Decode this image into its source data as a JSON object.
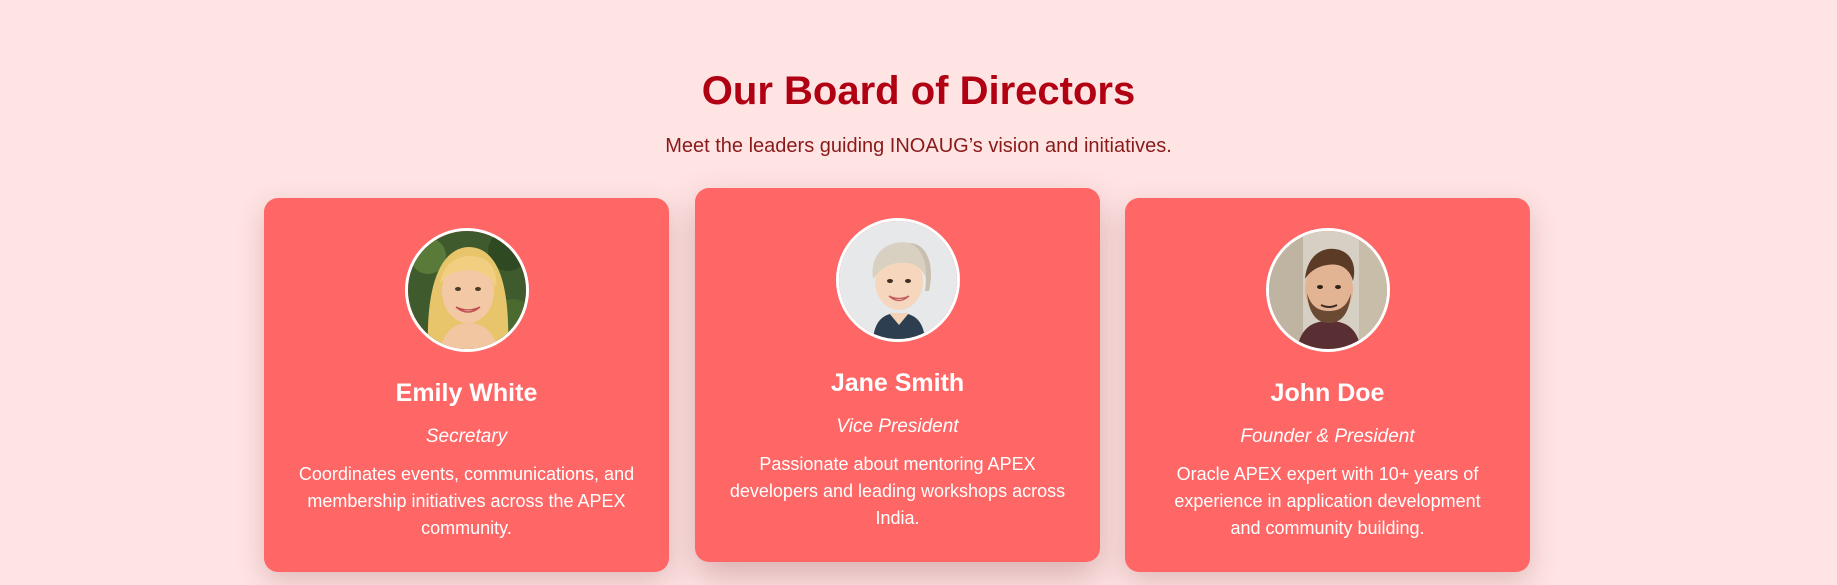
{
  "section": {
    "title": "Our Board of Directors",
    "subtitle": "Meet the leaders guiding INOAUG’s vision and initiatives."
  },
  "colors": {
    "background": "#ffe4e4",
    "title": "#b00012",
    "card": "#ff6666",
    "card_text": "#ffffff"
  },
  "directors": [
    {
      "name": "Emily White",
      "role": "Secretary",
      "bio": "Coordinates events, communications, and membership initiatives across the APEX community.",
      "avatar_icon": "woman-blonde-photo"
    },
    {
      "name": "Jane Smith",
      "role": "Vice President",
      "bio": "Passionate about mentoring APEX developers and leading workshops across India.",
      "avatar_icon": "woman-short-hair-photo"
    },
    {
      "name": "John Doe",
      "role": "Founder & President",
      "bio": "Oracle APEX expert with 10+ years of experience in application development and community building.",
      "avatar_icon": "man-beard-photo"
    }
  ]
}
